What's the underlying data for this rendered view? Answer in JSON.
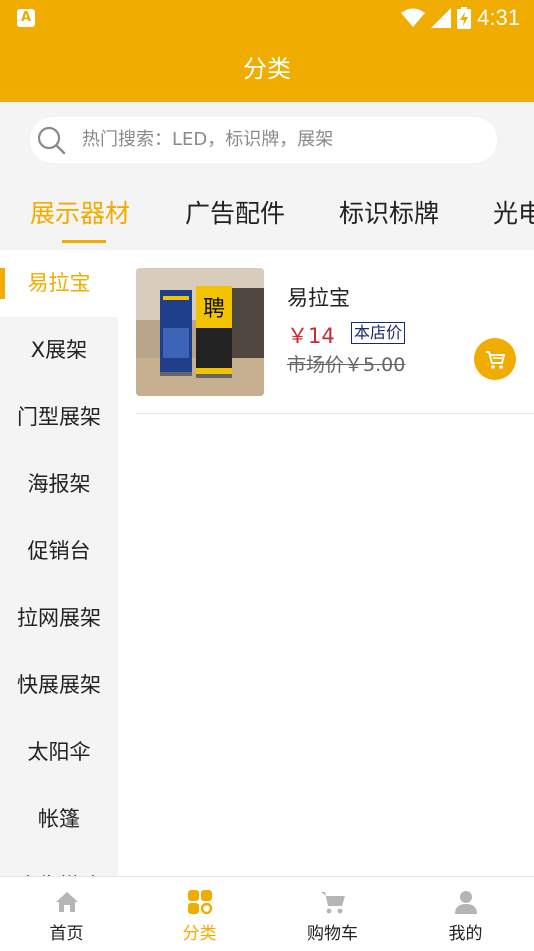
{
  "status_bar": {
    "time": "4:31",
    "app_badge": "A"
  },
  "header": {
    "title": "分类"
  },
  "search": {
    "placeholder": "热门搜索：LED，标识牌，展架"
  },
  "tabs": [
    {
      "label": "展示器材",
      "active": true
    },
    {
      "label": "广告配件",
      "active": false
    },
    {
      "label": "标识标牌",
      "active": false
    },
    {
      "label": "光电",
      "active": false
    }
  ],
  "sidebar": {
    "items": [
      {
        "label": "易拉宝",
        "active": true
      },
      {
        "label": "X展架",
        "active": false
      },
      {
        "label": "门型展架",
        "active": false
      },
      {
        "label": "海报架",
        "active": false
      },
      {
        "label": "促销台",
        "active": false
      },
      {
        "label": "拉网展架",
        "active": false
      },
      {
        "label": "快展展架",
        "active": false
      },
      {
        "label": "太阳伞",
        "active": false
      },
      {
        "label": "帐篷",
        "active": false
      },
      {
        "label": "广告搭建",
        "active": false
      }
    ]
  },
  "products": [
    {
      "name": "易拉宝",
      "price": "￥14",
      "price_tag": "本店价",
      "market_price": "市场价￥5.00",
      "image_text": "聘"
    }
  ],
  "bottom_nav": [
    {
      "label": "首页",
      "icon": "home-icon",
      "active": false
    },
    {
      "label": "分类",
      "icon": "category-icon",
      "active": true
    },
    {
      "label": "购物车",
      "icon": "cart-icon",
      "active": false
    },
    {
      "label": "我的",
      "icon": "user-icon",
      "active": false
    }
  ],
  "colors": {
    "accent": "#f0ac00",
    "price": "#d0262f",
    "tag": "#1a2a6e"
  }
}
